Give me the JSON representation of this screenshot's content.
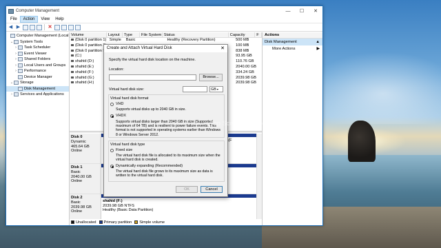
{
  "window": {
    "title": "Computer Management"
  },
  "window_controls": {
    "minimize": "—",
    "maximize": "☐",
    "close": "✕"
  },
  "menu": [
    "File",
    "Action",
    "View",
    "Help"
  ],
  "tree": [
    {
      "label": "Computer Management (Local",
      "exp": "",
      "indent": 0
    },
    {
      "label": "System Tools",
      "exp": "⌄",
      "indent": 1
    },
    {
      "label": "Task Scheduler",
      "exp": "›",
      "indent": 2
    },
    {
      "label": "Event Viewer",
      "exp": "›",
      "indent": 2
    },
    {
      "label": "Shared Folders",
      "exp": "›",
      "indent": 2
    },
    {
      "label": "Local Users and Groups",
      "exp": "›",
      "indent": 2
    },
    {
      "label": "Performance",
      "exp": "›",
      "indent": 2
    },
    {
      "label": "Device Manager",
      "exp": "",
      "indent": 2
    },
    {
      "label": "Storage",
      "exp": "⌄",
      "indent": 1
    },
    {
      "label": "Disk Management",
      "exp": "",
      "indent": 2,
      "selected": true
    },
    {
      "label": "Services and Applications",
      "exp": "›",
      "indent": 1
    }
  ],
  "volume_table": {
    "headers": [
      "Volume",
      "Layout",
      "Type",
      "File System",
      "Status",
      "Capacity",
      "F"
    ],
    "rows": [
      [
        "(Disk 0 partition 1)",
        "Simple",
        "Basic",
        "",
        "Healthy (Recovery Partition)",
        "500 MB",
        ""
      ],
      [
        "(Disk 0 partition 2)",
        "",
        "",
        "",
        "",
        "100 MB",
        ""
      ],
      [
        "(Disk 0 partition 5)",
        "",
        "",
        "",
        "",
        "838 MB",
        ""
      ],
      [
        "(C:)",
        "",
        "",
        "",
        "",
        "93.95 GB",
        ""
      ],
      [
        "shahid (D:)",
        "",
        "",
        "",
        "",
        "110.76 GB",
        ""
      ],
      [
        "shahid (E:)",
        "",
        "",
        "",
        "",
        "2040.00 GB",
        ""
      ],
      [
        "shahid (F:)",
        "",
        "",
        "",
        "",
        "334.24 GB",
        ""
      ],
      [
        "shahid (G:)",
        "",
        "",
        "",
        "",
        "2039.98 GB",
        ""
      ],
      [
        "shahid (H:)",
        "",
        "",
        "",
        "",
        "2039.98 GB",
        ""
      ]
    ]
  },
  "disks": [
    {
      "name": "Disk 0",
      "type": "Dynamic",
      "size": "465.64 GB",
      "status": "Online",
      "parts": [
        {
          "label": "",
          "line2": "",
          "line3": "MB",
          "style": "primary"
        },
        {
          "label": "",
          "line2": "",
          "line3": "y (F",
          "style": "primary"
        }
      ]
    },
    {
      "name": "Disk 1",
      "type": "Basic",
      "size": "2040.00 GB",
      "status": "Online",
      "parts": []
    },
    {
      "name": "Disk 2",
      "type": "Basic",
      "size": "2039.98 GB",
      "status": "Online",
      "parts": [
        {
          "label": "shahid  (F:)",
          "line2": "2039.98 GB NTFS",
          "line3": "Healthy (Basic Data Partition)",
          "style": "primary"
        }
      ]
    }
  ],
  "legend": [
    "Unallocated",
    "Primary partition",
    "Simple volume"
  ],
  "legend_colors": [
    "#111111",
    "#1b3a8f",
    "#c8a020"
  ],
  "actions": {
    "header": "Actions",
    "section": "Disk Management",
    "more": "More Actions"
  },
  "dialog": {
    "title": "Create and Attach Virtual Hard Disk",
    "intro": "Specify the virtual hard disk location on the machine.",
    "location_label": "Location:",
    "location_value": "",
    "browse": "Browse...",
    "size_label": "Virtual hard disk size:",
    "size_value": "",
    "size_unit": "GB",
    "format_label": "Virtual hard disk format",
    "vhd_label": "VHD",
    "vhd_desc": "Supports virtual disks up to 2040 GB in size.",
    "vhdx_label": "VHDX",
    "vhdx_desc": "Supports virtual disks larger than 2040 GB in size (Supported maximum of 64 TB) and is resilient to power failure events. This format is not supported in operating systems earlier than Windows 8 or Windows Server 2012.",
    "type_label": "Virtual hard disk type",
    "fixed_label": "Fixed size",
    "fixed_desc": "The virtual hard disk file is allocated to its maximum size when the virtual hard disk is created.",
    "dynamic_label": "Dynamically expanding (Recommended)",
    "dynamic_desc": "The virtual hard disk file grows to its maximum size as data is written to the virtual hard disk.",
    "ok": "OK",
    "cancel": "Cancel",
    "close": "✕"
  },
  "watermark": "Top Screen Recorder"
}
